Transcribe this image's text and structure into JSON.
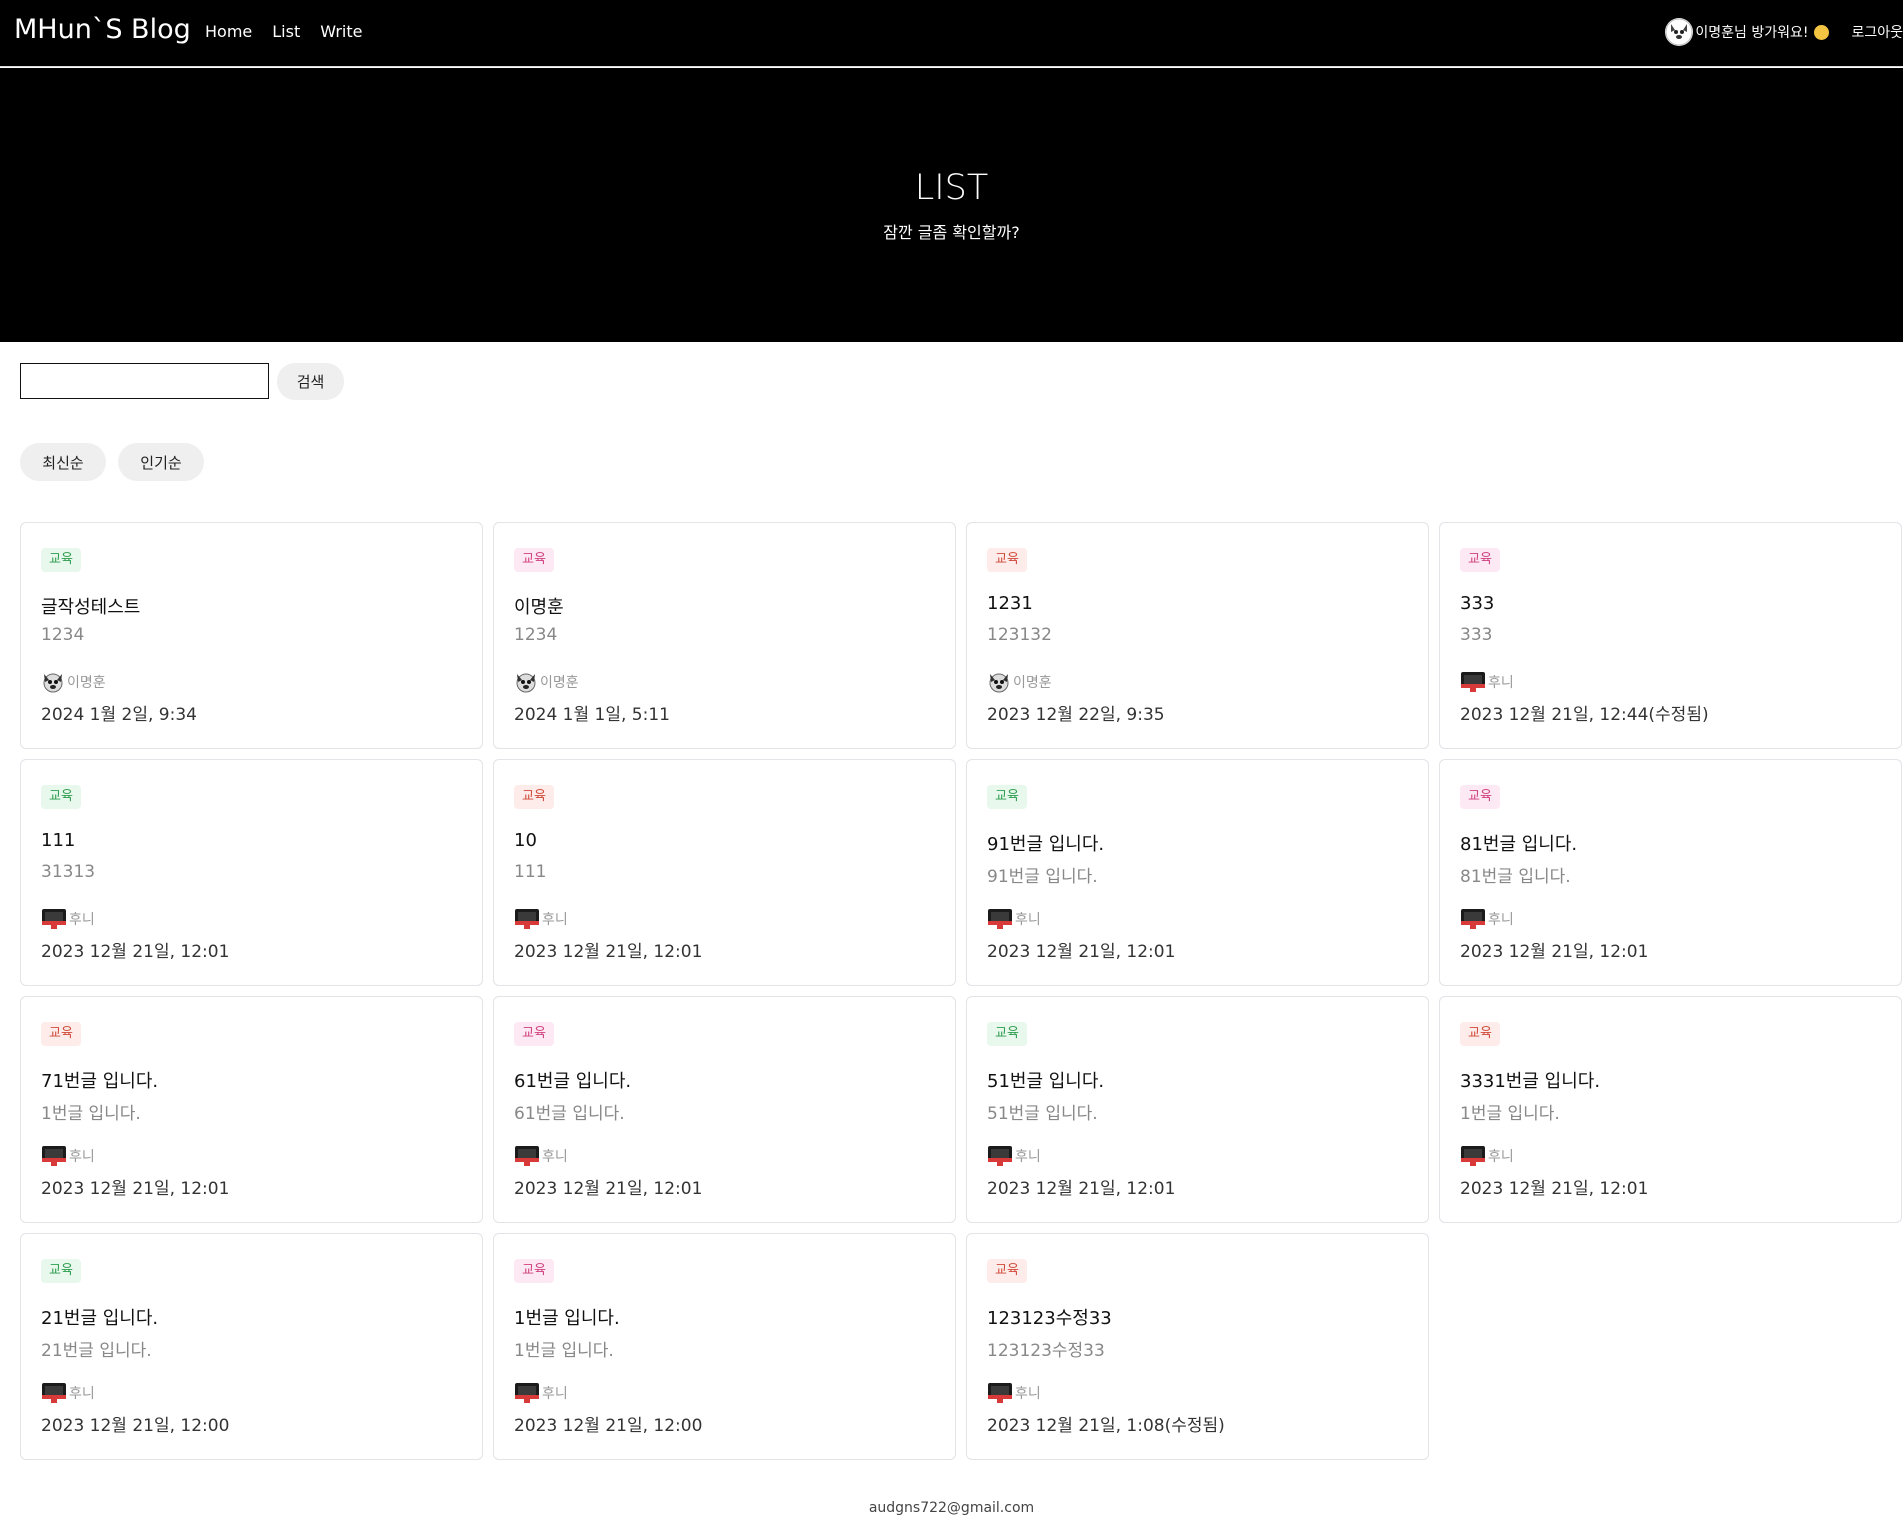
{
  "header": {
    "brand": "MHun`S Blog",
    "nav": [
      "Home",
      "List",
      "Write"
    ],
    "welcome": "이명훈님 방가워요!",
    "logout": "로그아웃"
  },
  "hero": {
    "title": "LIST",
    "subtitle": "잠깐 글좀 확인할까?"
  },
  "search": {
    "value": "",
    "button": "검색"
  },
  "sort": [
    "최신순",
    "인기순"
  ],
  "posts": [
    {
      "tag": "교육",
      "tag_color": "green",
      "title": "글작성테스트",
      "body": "1234",
      "author": "이명훈",
      "author_icon": "dog-avatar-icon",
      "date": "2024 1월 2일, 9:34"
    },
    {
      "tag": "교육",
      "tag_color": "pink",
      "title": "이명훈",
      "body": "1234",
      "author": "이명훈",
      "author_icon": "dog-avatar-icon",
      "date": "2024 1월 1일, 5:11"
    },
    {
      "tag": "교육",
      "tag_color": "red",
      "title": "1231",
      "body": "123132",
      "author": "이명훈",
      "author_icon": "dog-avatar-icon",
      "date": "2023 12월 22일, 9:35"
    },
    {
      "tag": "교육",
      "tag_color": "pink",
      "title": "333",
      "body": "333",
      "author": "후니",
      "author_icon": "computer-avatar-icon",
      "date": "2023 12월 21일, 12:44(수정됨)"
    },
    {
      "tag": "교육",
      "tag_color": "green",
      "title": "111",
      "body": "31313",
      "author": "후니",
      "author_icon": "computer-avatar-icon",
      "date": "2023 12월 21일, 12:01"
    },
    {
      "tag": "교육",
      "tag_color": "red",
      "title": "10",
      "body": "111",
      "author": "후니",
      "author_icon": "computer-avatar-icon",
      "date": "2023 12월 21일, 12:01"
    },
    {
      "tag": "교육",
      "tag_color": "green",
      "title": "91번글 입니다.",
      "body": "91번글 입니다.",
      "author": "후니",
      "author_icon": "computer-avatar-icon",
      "date": "2023 12월 21일, 12:01"
    },
    {
      "tag": "교육",
      "tag_color": "pink",
      "title": "81번글 입니다.",
      "body": "81번글 입니다.",
      "author": "후니",
      "author_icon": "computer-avatar-icon",
      "date": "2023 12월 21일, 12:01"
    },
    {
      "tag": "교육",
      "tag_color": "red",
      "title": "71번글 입니다.",
      "body": "1번글 입니다.",
      "author": "후니",
      "author_icon": "computer-avatar-icon",
      "date": "2023 12월 21일, 12:01"
    },
    {
      "tag": "교육",
      "tag_color": "pink",
      "title": "61번글 입니다.",
      "body": "61번글 입니다.",
      "author": "후니",
      "author_icon": "computer-avatar-icon",
      "date": "2023 12월 21일, 12:01"
    },
    {
      "tag": "교육",
      "tag_color": "green",
      "title": "51번글 입니다.",
      "body": "51번글 입니다.",
      "author": "후니",
      "author_icon": "computer-avatar-icon",
      "date": "2023 12월 21일, 12:01"
    },
    {
      "tag": "교육",
      "tag_color": "red",
      "title": "3331번글 입니다.",
      "body": "1번글 입니다.",
      "author": "후니",
      "author_icon": "computer-avatar-icon",
      "date": "2023 12월 21일, 12:01"
    },
    {
      "tag": "교육",
      "tag_color": "green",
      "title": "21번글 입니다.",
      "body": "21번글 입니다.",
      "author": "후니",
      "author_icon": "computer-avatar-icon",
      "date": "2023 12월 21일, 12:00"
    },
    {
      "tag": "교육",
      "tag_color": "pink",
      "title": "1번글 입니다.",
      "body": "1번글 입니다.",
      "author": "후니",
      "author_icon": "computer-avatar-icon",
      "date": "2023 12월 21일, 12:00"
    },
    {
      "tag": "교육",
      "tag_color": "red",
      "title": "123123수정33",
      "body": "123123수정33",
      "author": "후니",
      "author_icon": "computer-avatar-icon",
      "date": "2023 12월 21일, 1:08(수정됨)"
    }
  ],
  "footer": {
    "email": "audgns722@gmail.com"
  }
}
